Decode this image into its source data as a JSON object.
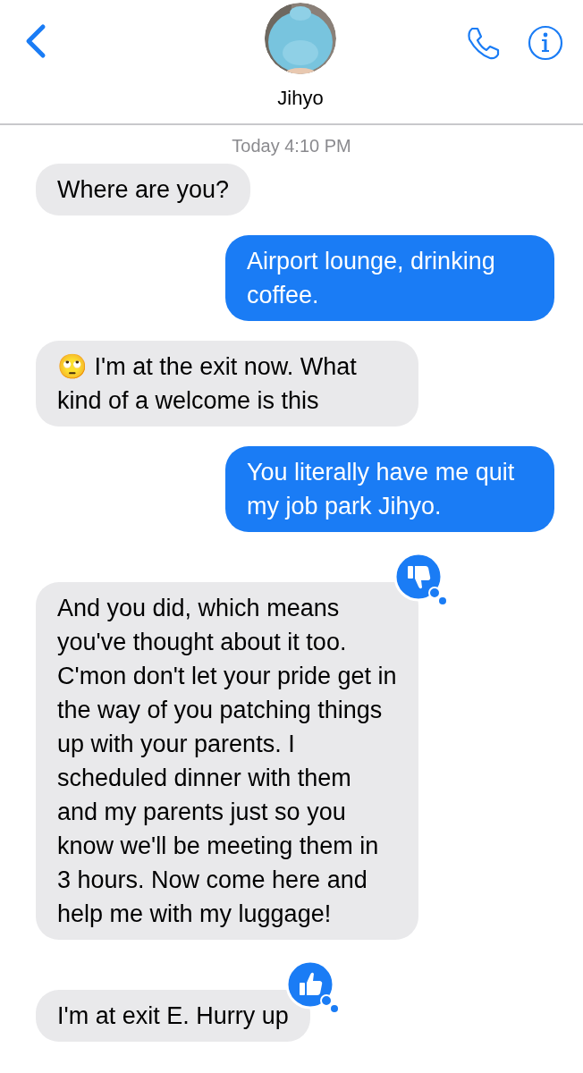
{
  "header": {
    "contact_name": "Jihyo"
  },
  "timestamp": "Today 4:10 PM",
  "messages": [
    {
      "kind": "received",
      "text": "Where are you?"
    },
    {
      "kind": "sent",
      "text": "Airport lounge, drinking coffee."
    },
    {
      "kind": "received",
      "text": "🙄 I'm at the exit now. What kind of a welcome is this"
    },
    {
      "kind": "sent",
      "text": "You literally have me quit my job park Jihyo."
    },
    {
      "kind": "received",
      "text": "And you did, which means you've thought about it too. C'mon don't let your pride get in the way of you patching things up with your parents. I scheduled dinner with them and my parents just so you know we'll be meeting them in 3 hours. Now come here and help me with my luggage!",
      "reaction": {
        "kind": "dislike"
      }
    },
    {
      "kind": "received",
      "text": "I'm at exit E. Hurry up",
      "reaction": {
        "kind": "like"
      }
    }
  ]
}
